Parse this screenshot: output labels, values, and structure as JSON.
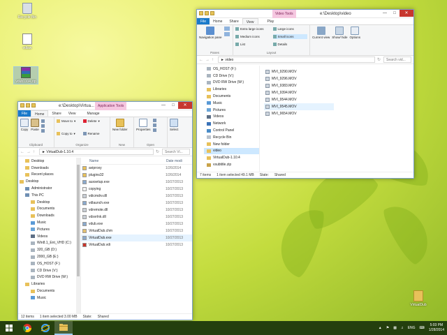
{
  "desktop": {
    "icons": [
      {
        "label": "Recycle Bin",
        "icon": "recycle-bin-icon"
      },
      {
        "label": "vdlaw",
        "icon": "file-icon"
      },
      {
        "label": "vdub1104.zip",
        "icon": "winrar-icon"
      },
      {
        "label": "VirtualDub",
        "icon": "folder-icon"
      }
    ]
  },
  "video_window": {
    "context_tab": "Video Tools",
    "title": "e:\\Desktop\\video",
    "tabs": [
      "File",
      "Home",
      "Share",
      "View",
      "Play"
    ],
    "ribbon": {
      "navigation_pane": "Navigation pane",
      "panes_label": "Panes",
      "layout_options": [
        "Extra large icons",
        "Large icons",
        "Medium icons",
        "Small icons",
        "List",
        "Details"
      ],
      "layout_label": "Layout",
      "current_view": "Current view",
      "show_hide": "Show/ hide",
      "options": "Options"
    },
    "address": {
      "path": "video",
      "search_placeholder": "Search vid..."
    },
    "nav_items": [
      "OS_HOST (F:)",
      "CD Drive (V:)",
      "DVD RW Drive (W:)",
      "Libraries",
      "Documents",
      "Music",
      "Pictures",
      "Videos",
      "Network",
      "Control Panel",
      "Recycle Bin",
      "New folder",
      "video",
      "VirtualDub-1.10.4",
      "vsubtitle.zip"
    ],
    "files": [
      "MVI_9290.MOV",
      "MVI_9296.MOV",
      "MVI_9383.MOV",
      "MVI_9394.MOV",
      "MVI_9544.MOV",
      "MVI_9545.MOV",
      "MVI_9654.MOV"
    ],
    "status": {
      "items": "7 items",
      "selected": "1 item selected 49.1 MB",
      "state": "State:",
      "shared": "Shared"
    }
  },
  "vdub_window": {
    "context_tab": "Application Tools",
    "title": "e:\\Desktop\\Virtua...",
    "tabs": [
      "File",
      "Home",
      "Share",
      "View",
      "Manage"
    ],
    "ribbon": {
      "copy": "Copy",
      "paste": "Paste",
      "clipboard": "Clipboard",
      "move_to": "Move to",
      "copy_to": "Copy to",
      "delete": "Delete",
      "rename": "Rename",
      "organize": "Organize",
      "new_folder": "New folder",
      "new": "New",
      "properties": "Properties",
      "open": "Open",
      "select": "Select"
    },
    "address": {
      "path": "VirtualDub-1.10.4",
      "search_placeholder": "Search Vi..."
    },
    "columns": {
      "name": "Name",
      "date": "Date modi"
    },
    "nav_items": [
      "Desktop",
      "Downloads",
      "Recent places",
      "Desktop",
      "Administrator",
      "This PC",
      "Desktop",
      "Documents",
      "Downloads",
      "Music",
      "Pictures",
      "Videos",
      "Win8.1_Ent_VHD (C:)",
      "320_GB (D:)",
      "2000_GB (E:)",
      "OS_HOST (F:)",
      "CD Drive (V:)",
      "DVD RW Drive (W:)",
      "Libraries",
      "Documents",
      "Music"
    ],
    "files": [
      {
        "name": "aviproxy",
        "date": "1/26/2014",
        "icon": "folder-icon"
      },
      {
        "name": "plugins32",
        "date": "1/26/2014",
        "icon": "folder-icon"
      },
      {
        "name": "auxsetup.exe",
        "date": "10/27/2013",
        "icon": "exe-icon"
      },
      {
        "name": "copying",
        "date": "10/27/2013",
        "icon": "doc-icon"
      },
      {
        "name": "vdicmdrv.dll",
        "date": "10/27/2013",
        "icon": "dll-icon"
      },
      {
        "name": "vdlaunch.exe",
        "date": "10/27/2013",
        "icon": "exe-icon"
      },
      {
        "name": "vdremote.dll",
        "date": "10/27/2013",
        "icon": "dll-icon"
      },
      {
        "name": "vdsvrlnk.dll",
        "date": "10/27/2013",
        "icon": "dll-icon"
      },
      {
        "name": "vdub.exe",
        "date": "10/27/2013",
        "icon": "exe-icon"
      },
      {
        "name": "VirtualDub.chm",
        "date": "10/27/2013",
        "icon": "chm-icon"
      },
      {
        "name": "VirtualDub.exe",
        "date": "10/27/2013",
        "icon": "exe-icon"
      },
      {
        "name": "VirtualDub.vdi",
        "date": "10/27/2013",
        "icon": "vdi-icon"
      }
    ],
    "status": {
      "items": "12 items",
      "selected": "1 item selected 3.00 MB",
      "state": "State:",
      "shared": "Shared"
    }
  },
  "taskbar": {
    "lang": "ENG",
    "time": "5:03 PM",
    "date": "1/28/2014"
  }
}
